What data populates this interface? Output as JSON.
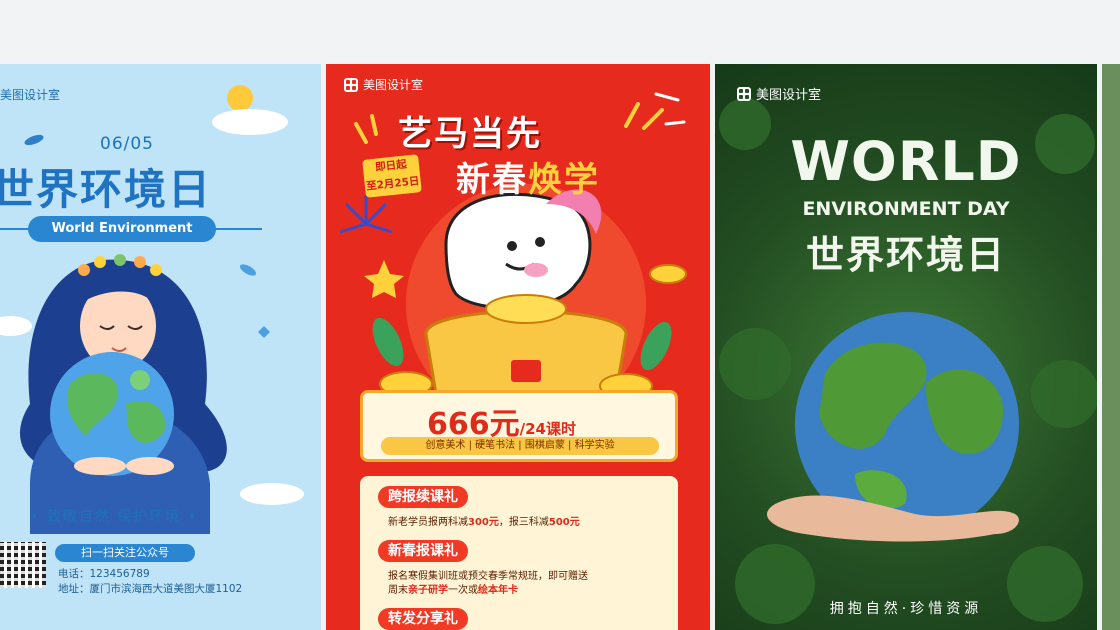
{
  "gallery": {
    "cards": [
      {
        "brand": "美图设计室",
        "date": "06/05",
        "title": "世界环境日",
        "subtitle": "World Environment",
        "slogan": "•  致敬自然  保护环境  •",
        "qr_label": "扫一扫关注公众号",
        "phone": "电话：123456789",
        "address": "地址：厦门市滨海西大道美图大厦1102",
        "colors": {
          "bg": "#bfe3f7",
          "accent": "#2b86d2"
        }
      },
      {
        "brand": "美图设计室",
        "headline": "艺马当先",
        "date_badge_line1": "即日起",
        "date_badge_line2": "至2月25日",
        "headline2_part1": "新春",
        "headline2_part2": "焕学",
        "price": "666元",
        "price_unit": "/24课时",
        "subjects": "创意美术 | 硬笔书法 | 围棋启蒙 | 科学实验",
        "promo1_tag": "跨报续课礼",
        "promo1_text_a": "新老学员报两科减",
        "promo1_value_a": "300元",
        "promo1_text_b": "，报三科减",
        "promo1_value_b": "500元",
        "promo2_tag": "新春报课礼",
        "promo2_text_line1": "报名寒假集训班或预交春季常规班，即可赠送",
        "promo2_text_line2a": "周末",
        "promo2_value": "亲子研学",
        "promo2_text_line2b": "一次或",
        "promo2_value2": "绘本年卡",
        "promo3_tag": "转发分享礼",
        "colors": {
          "bg": "#e62b1e",
          "yellow": "#ffd23c"
        }
      },
      {
        "brand": "美图设计室",
        "line1": "WORLD",
        "line2": "ENVIRONMENT DAY",
        "line3": "世界环境日",
        "footer": "拥抱自然·珍惜资源",
        "colors": {
          "bg": "#234d22"
        }
      }
    ]
  }
}
